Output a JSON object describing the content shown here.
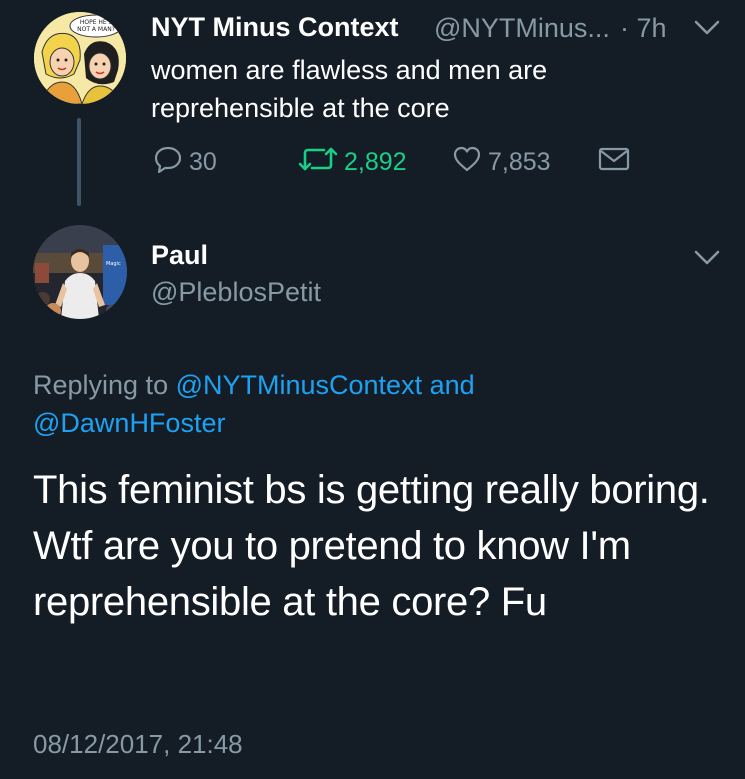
{
  "parent_tweet": {
    "name": "NYT Minus Context",
    "handle": "@NYTMinus...",
    "time": "· 7h",
    "text": "women are flawless and men are reprehensible at the core",
    "avatar_speech": "HOPE HE'S NOT A MAN?",
    "actions": {
      "replies": "30",
      "retweets": "2,892",
      "likes": "7,853"
    }
  },
  "reply_tweet": {
    "name": "Paul",
    "handle": "@PleblosPetit",
    "replying_prefix": "Replying to ",
    "replying_mention_1": "@NYTMinusContext",
    "replying_and": " and ",
    "replying_mention_2": "@DawnHFoster",
    "text": "This feminist bs is getting really boring. Wtf are you to pretend to know I'm reprehensible at the core? Fu",
    "timestamp": "08/12/2017, 21:48"
  },
  "icons": {
    "reply": "reply-icon",
    "retweet": "retweet-icon",
    "like": "heart-icon",
    "dm": "envelope-icon",
    "menu": "chevron-down-icon"
  },
  "colors": {
    "background": "#141d26",
    "secondary_text": "#8899a6",
    "link": "#1da1f2",
    "retweeted": "#19cf86",
    "thread_line": "#3d5466"
  }
}
